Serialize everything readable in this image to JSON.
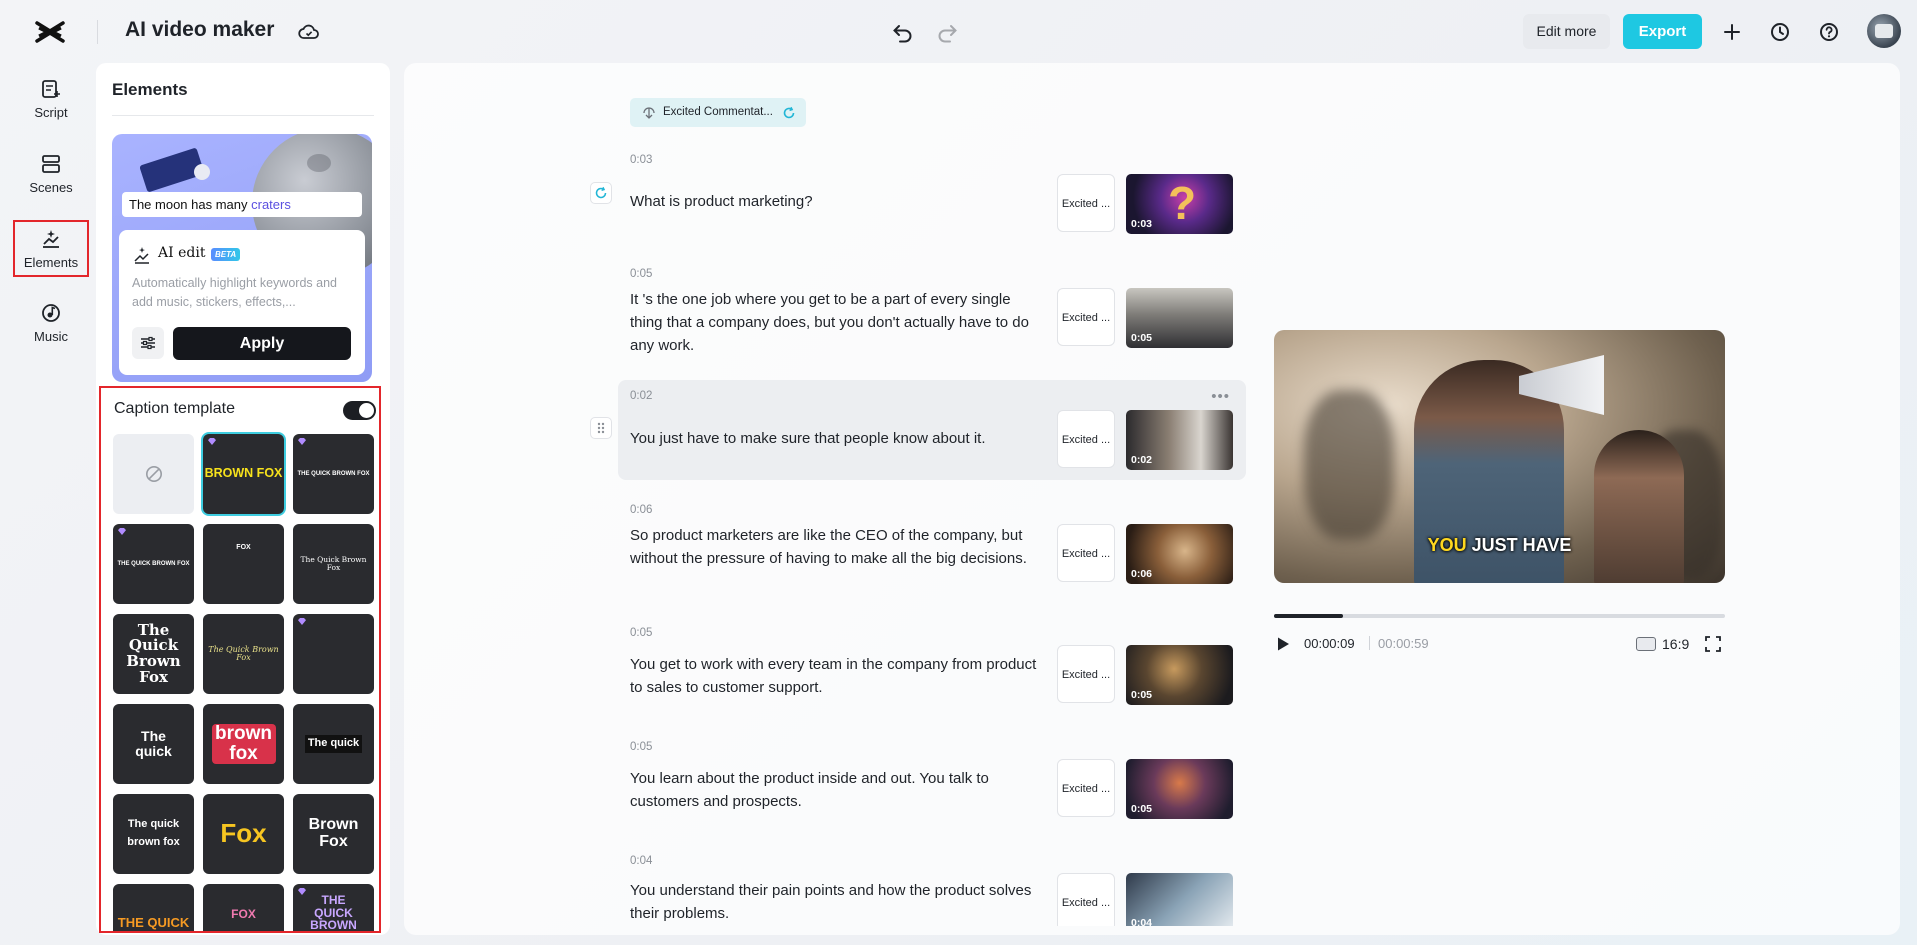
{
  "app": {
    "title": "AI video maker"
  },
  "toolbar": {
    "edit_more_label": "Edit more",
    "export_label": "Export"
  },
  "nav": [
    {
      "label": "Script",
      "icon": "script-icon"
    },
    {
      "label": "Scenes",
      "icon": "scenes-icon"
    },
    {
      "label": "Elements",
      "icon": "elements-icon",
      "active": true
    },
    {
      "label": "Music",
      "icon": "music-icon"
    }
  ],
  "panel": {
    "title": "Elements",
    "ai_card": {
      "preview_text": "The moon has many ",
      "preview_highlight": "craters",
      "title": "AI edit",
      "badge": "BETA",
      "description": "Automatically highlight keywords and add music, stickers, effects,...",
      "apply_label": "Apply"
    },
    "caption": {
      "title": "Caption template",
      "enabled": true,
      "templates": [
        {
          "id": "none",
          "text": ""
        },
        {
          "id": "brown-fox-yellow",
          "text": "BROWN FOX"
        },
        {
          "id": "quick-brown-fox-green",
          "text": "THE QUICK BROWN FOX"
        },
        {
          "id": "quick-brown-fox-white",
          "text": "THE QUICK BROWN FOX"
        },
        {
          "id": "fox-small",
          "text": "FOX"
        },
        {
          "id": "quick-brown-fox-serif",
          "text": "The Quick Brown Fox"
        },
        {
          "id": "quick-brown-serif-large",
          "text": "The Quick Brown Fox"
        },
        {
          "id": "quick-brown-script",
          "text": "The Quick Brown Fox"
        },
        {
          "id": "blank-premium",
          "text": ""
        },
        {
          "id": "the-quick-stacked",
          "text": "The quick"
        },
        {
          "id": "brown-fox-red",
          "text": "brown fox"
        },
        {
          "id": "the-quick-boxed",
          "text": "The quick"
        },
        {
          "id": "quick-brown-fox-yellow-word",
          "text": "The quick brown fox"
        },
        {
          "id": "fox-yellow",
          "text": "Fox"
        },
        {
          "id": "brown-fox-condensed",
          "text": "Brown Fox"
        },
        {
          "id": "the-quick-orange",
          "text": "THE QUICK"
        },
        {
          "id": "fox-pink",
          "text": "FOX"
        },
        {
          "id": "quick-brown-fox-purple",
          "text": "THE QUICK BROWN FOX"
        }
      ]
    }
  },
  "script": {
    "voice_label": "Excited Commentat...",
    "scenes": [
      {
        "time": "0:03",
        "text": "What is product marketing?",
        "voice": "Excited ...",
        "duration": "0:03"
      },
      {
        "time": "0:05",
        "text": "It 's the one job where you get to be a part of every single thing that a company does, but you don't actually have to do any work.",
        "voice": "Excited ...",
        "duration": "0:05"
      },
      {
        "time": "0:02",
        "text": "You just have to make sure that people know about it.",
        "voice": "Excited ...",
        "duration": "0:02",
        "active": true
      },
      {
        "time": "0:06",
        "text": "So product marketers are like the CEO of the company, but without the pressure of having to make all the big decisions.",
        "voice": "Excited ...",
        "duration": "0:06"
      },
      {
        "time": "0:05",
        "text": "You get to work with every team in the company from product to sales to customer support.",
        "voice": "Excited ...",
        "duration": "0:05"
      },
      {
        "time": "0:05",
        "text": "You learn about the product inside and out. You talk to customers and prospects.",
        "voice": "Excited ...",
        "duration": "0:05"
      },
      {
        "time": "0:04",
        "text": "You understand their pain points and how the product solves their problems.",
        "voice": "Excited ...",
        "duration": "0:04"
      }
    ]
  },
  "preview": {
    "subtitle_highlight": "YOU",
    "subtitle_rest": " JUST HAVE",
    "current_time": "00:00:09",
    "total_time": "00:00:59",
    "progress": 0.153,
    "aspect_ratio": "16:9"
  },
  "colors": {
    "accent": "#1ec8e2",
    "highlight_outline": "#e3262b"
  }
}
